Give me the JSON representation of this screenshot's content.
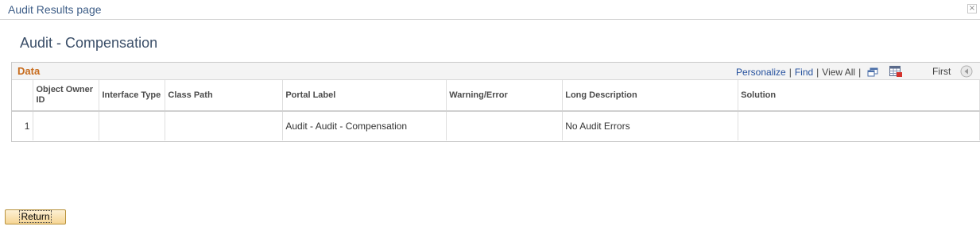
{
  "window": {
    "title": "Audit Results page",
    "close_glyph": "×"
  },
  "page": {
    "title": "Audit - Compensation"
  },
  "grid": {
    "caption": "Data",
    "personalize": "Personalize",
    "find": "Find",
    "separator": "|",
    "view_all": "View All",
    "first": "First",
    "columns": [
      "",
      "Object Owner ID",
      "Interface Type",
      "Class Path",
      "Portal Label",
      "Warning/Error",
      "Long Description",
      "Solution"
    ],
    "rows": [
      [
        "1",
        "",
        "",
        "",
        "Audit - Audit - Compensation",
        "",
        "No Audit Errors",
        ""
      ]
    ]
  },
  "footer": {
    "return_label": "Return"
  },
  "icons": {
    "new_window": "new-window-icon",
    "download": "spreadsheet-download-icon",
    "previous": "previous-arrow-icon"
  },
  "colors": {
    "title": "#3d5d87",
    "caption": "#c76b1c",
    "link": "#25519e",
    "button": "#f6d594"
  }
}
